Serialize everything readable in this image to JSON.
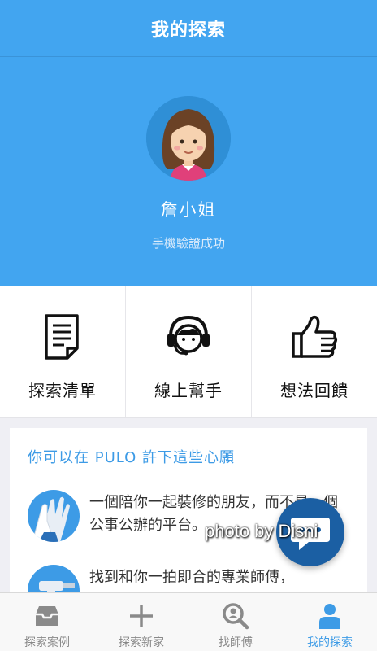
{
  "header": {
    "title": "我的探索"
  },
  "profile": {
    "name": "詹小姐",
    "status": "手機驗證成功"
  },
  "quick_actions": [
    {
      "label": "探索清單",
      "icon": "document-icon"
    },
    {
      "label": "線上幫手",
      "icon": "headset-support-icon"
    },
    {
      "label": "想法回饋",
      "icon": "thumbs-up-icon"
    }
  ],
  "wishes": {
    "title": "你可以在 PULO 許下這些心願",
    "items": [
      {
        "text": "一個陪你一起裝修的朋友，而不是一個公事公辦的平台。",
        "icon": "high-five-icon"
      },
      {
        "text": "找到和你一拍即合的專業師傅，",
        "icon": "drill-tool-icon"
      }
    ]
  },
  "watermark": "photo by Disni",
  "tabs": [
    {
      "label": "探索案例",
      "icon": "inbox-icon",
      "active": false
    },
    {
      "label": "探索新家",
      "icon": "plus-icon",
      "active": false
    },
    {
      "label": "找師傅",
      "icon": "search-person-icon",
      "active": false
    },
    {
      "label": "我的探索",
      "icon": "user-icon",
      "active": true
    }
  ],
  "colors": {
    "primary": "#42a5f0",
    "accent": "#3d9be6",
    "fab": "#1b5fa3",
    "tab_inactive": "#888888"
  }
}
